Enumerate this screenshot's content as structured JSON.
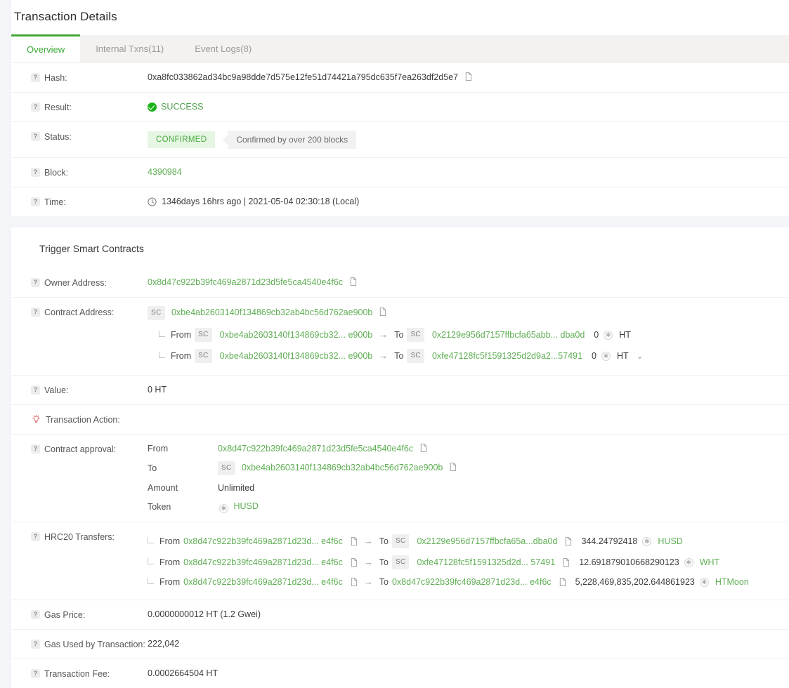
{
  "header": {
    "title": "Transaction Details",
    "tabs": [
      {
        "label": "Overview",
        "active": true
      },
      {
        "label": "Internal Txns(11)",
        "active": false
      },
      {
        "label": "Event Logs(8)",
        "active": false
      }
    ]
  },
  "overview": {
    "hash": {
      "label": "Hash:",
      "value": "0xa8fc033862ad34bc9a98dde7d575e12fe51d74421a795dc635f7ea263df2d5e7"
    },
    "result": {
      "label": "Result:",
      "value": "SUCCESS"
    },
    "status": {
      "label": "Status:",
      "badge": "CONFIRMED",
      "tooltip": "Confirmed by over 200 blocks"
    },
    "block": {
      "label": "Block:",
      "value": "4390984"
    },
    "time": {
      "label": "Time:",
      "value": "1346days 16hrs ago | 2021-05-04 02:30:18 (Local)"
    }
  },
  "contract": {
    "section_title": "Trigger Smart Contracts",
    "owner_address": {
      "label": "Owner Address:",
      "value": "0x8d47c922b39fc469a2871d23d5fe5ca4540e4f6c"
    },
    "contract_address": {
      "label": "Contract Address:",
      "chip": "SC",
      "value": "0xbe4ab2603140f134869cb32ab4bc56d762ae900b",
      "internal": [
        {
          "from_label": "From",
          "from_chip": "SC",
          "from": "0xbe4ab2603140f134869cb32... e900b",
          "to_label": "To",
          "to_chip": "SC",
          "to": "0x2129e956d7157ffbcfa65abb... dba0d",
          "amount": "0",
          "token": "HT",
          "expandable": false
        },
        {
          "from_label": "From",
          "from_chip": "SC",
          "from": "0xbe4ab2603140f134869cb32... e900b",
          "to_label": "To",
          "to_chip": "SC",
          "to": "0xfe47128fc5f1591325d2d9a2...57491",
          "amount": "0",
          "token": "HT",
          "expandable": true
        }
      ]
    },
    "value": {
      "label": "Value:",
      "value": "0 HT"
    },
    "transaction_action": {
      "label": "Transaction Action:"
    },
    "contract_approval": {
      "label": "Contract approval:",
      "from_key": "From",
      "from_value": "0x8d47c922b39fc469a2871d23d5fe5ca4540e4f6c",
      "to_key": "To",
      "to_chip": "SC",
      "to_value": "0xbe4ab2603140f134869cb32ab4bc56d762ae900b",
      "amount_key": "Amount",
      "amount_value": "Unlimited",
      "token_key": "Token",
      "token_value": "HUSD"
    },
    "hrc20_transfers": {
      "label": "HRC20 Transfers:",
      "rows": [
        {
          "from_label": "From",
          "from": "0x8d47c922b39fc469a2871d23d... e4f6c",
          "to_label": "To",
          "to_chip": "SC",
          "to": "0x2129e956d7157ffbcfa65a...dba0d",
          "amount": "344.24792418",
          "token": "HUSD"
        },
        {
          "from_label": "From",
          "from": "0x8d47c922b39fc469a2871d23d... e4f6c",
          "to_label": "To",
          "to_chip": "SC",
          "to": "0xfe47128fc5f1591325d2d... 57491",
          "amount": "12.691879010668290123",
          "token": "WHT"
        },
        {
          "from_label": "From",
          "from": "0x8d47c922b39fc469a2871d23d... e4f6c",
          "to_label": "To",
          "to_chip": "",
          "to": "0x8d47c922b39fc469a2871d23d... e4f6c",
          "amount": "5,228,469,835,202.644861923",
          "token": "HTMoon"
        }
      ]
    },
    "gas_price": {
      "label": "Gas Price:",
      "value": "0.0000000012 HT (1.2 Gwei)"
    },
    "gas_used": {
      "label": "Gas Used by Transaction:",
      "value": "222,042"
    },
    "transaction_fee": {
      "label": "Transaction Fee:",
      "value": "0.0002664504 HT"
    }
  },
  "colors": {
    "accent_green": "#46a836",
    "link_green": "#5fae54",
    "success_green": "#19b319",
    "badge_bg": "#e5f6e3",
    "page_bg": "#f4f5f9",
    "action_red": "#e0716f"
  }
}
